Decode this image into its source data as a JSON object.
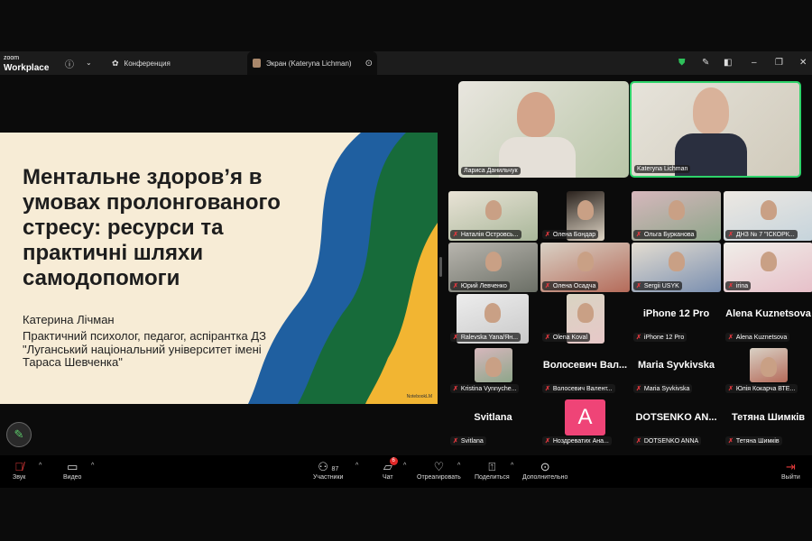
{
  "app": {
    "logo_small": "zoom",
    "logo_big": "Workplace"
  },
  "tabs": [
    {
      "label": "Конференция",
      "icon": "participants-icon"
    },
    {
      "label": "Экран (Kateryna Lichman)",
      "icon": "avatar"
    }
  ],
  "slide": {
    "title": "Ментальне здоров’я в умовах пролонгованого стресу: ресурси та практичні шляхи самодопомоги",
    "author": "Катерина Лічман",
    "description": "Практичний психолог, педагог, аспірантка ДЗ \"Луганський національний університет імені Тараса Шевченка\"",
    "watermark": "NotebookLM",
    "colors": {
      "blue": "#1f5fa0",
      "green": "#176b3a",
      "yellow": "#f2b532"
    }
  },
  "speakers": [
    {
      "name": "Лариса Данильчук"
    },
    {
      "name": "Kateryna Lichman",
      "active": true
    }
  ],
  "participants": [
    {
      "name": "Наталія Островсь...",
      "video": true
    },
    {
      "name": "Олена Бондар",
      "video": true
    },
    {
      "name": "Ольга Бурканова",
      "video": true
    },
    {
      "name": "ДНЗ № 7 \"ІСКОРК...",
      "video": true
    },
    {
      "name": "Юрий Левченко",
      "video": true
    },
    {
      "name": "Олена Осадча",
      "video": true
    },
    {
      "name": "Sergii USYK",
      "video": true
    },
    {
      "name": "irina",
      "video": true
    },
    {
      "name": "Ralevska Yana/Ян...",
      "video": true
    },
    {
      "name": "Olena Koval",
      "video": true
    },
    {
      "name": "iPhone 12 Pro",
      "display": "iPhone 12 Pro"
    },
    {
      "name": "Alena Kuznetsova",
      "display": "Alena Kuznetsova"
    },
    {
      "name": "Kristina Vynnyche...",
      "video": true
    },
    {
      "name": "Волосевич Валент...",
      "display": "Волосевич Вал..."
    },
    {
      "name": "Maria  Syvkivska",
      "display": "Maria  Syvkivska"
    },
    {
      "name": "Юлія Кокарча ВТЕ...",
      "video": true
    },
    {
      "name": "Svitlana",
      "display": "Svitlana"
    },
    {
      "name": "Ноздреватих Ана...",
      "initial": "A"
    },
    {
      "name": "DOTSENKO ANNA",
      "display": "DOTSENKO  AN..."
    },
    {
      "name": "Тетяна Шимків",
      "display": "Тетяна Шимків"
    }
  ],
  "toolbar": {
    "audio": "Звук",
    "video": "Видео",
    "participants": "Участники",
    "participants_count": "87",
    "chat": "Чат",
    "chat_badge": "6",
    "react": "Отреагировать",
    "share": "Поделиться",
    "more": "Дополнительно",
    "leave": "Выйти"
  }
}
